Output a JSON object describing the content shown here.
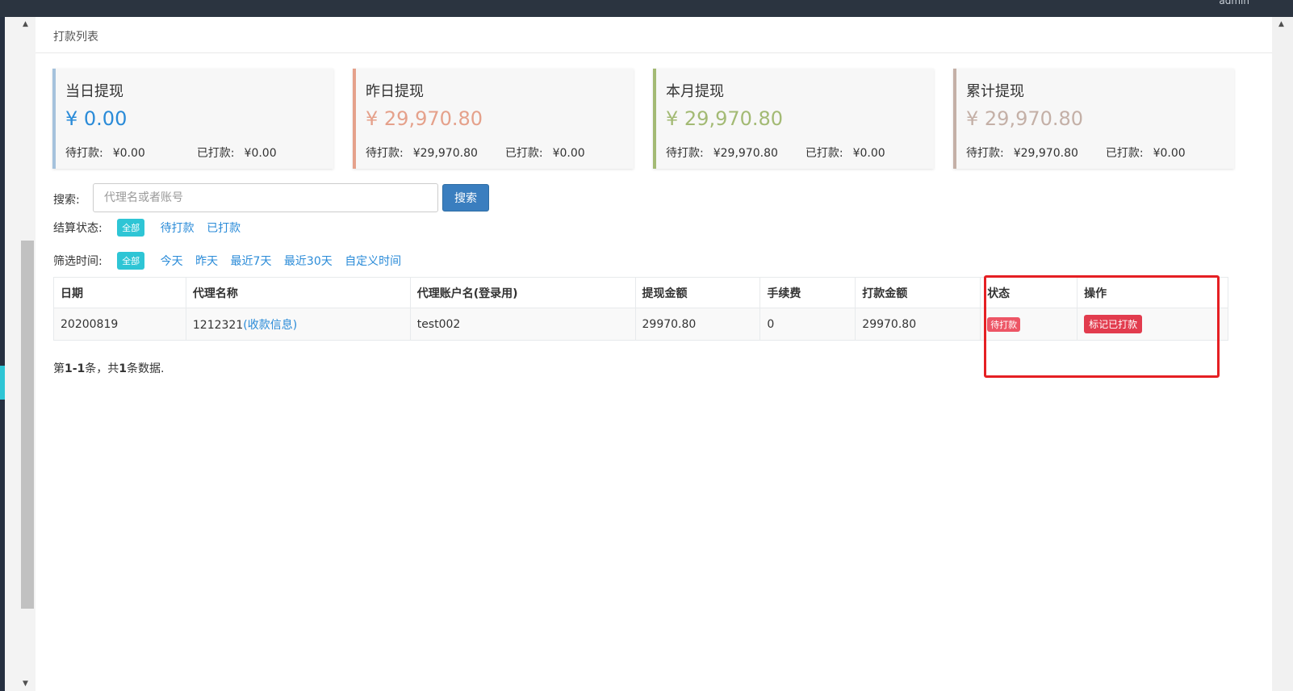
{
  "topbar": {
    "user": "admin"
  },
  "panel": {
    "title": "打款列表"
  },
  "stats": [
    {
      "title": "当日提现",
      "amount": "¥ 0.00",
      "pending_label": "待打款:",
      "pending_value": "¥0.00",
      "paid_label": "已打款:",
      "paid_value": "¥0.00",
      "accent": "#a5c2dc",
      "amount_color": "#2a8bd8"
    },
    {
      "title": "昨日提现",
      "amount": "¥ 29,970.80",
      "pending_label": "待打款:",
      "pending_value": "¥29,970.80",
      "paid_label": "已打款:",
      "paid_value": "¥0.00",
      "accent": "#e5a18b",
      "amount_color": "#e5a18b"
    },
    {
      "title": "本月提现",
      "amount": "¥ 29,970.80",
      "pending_label": "待打款:",
      "pending_value": "¥29,970.80",
      "paid_label": "已打款:",
      "paid_value": "¥0.00",
      "accent": "#a3ba74",
      "amount_color": "#a3ba74"
    },
    {
      "title": "累计提现",
      "amount": "¥ 29,970.80",
      "pending_label": "待打款:",
      "pending_value": "¥29,970.80",
      "paid_label": "已打款:",
      "paid_value": "¥0.00",
      "accent": "#c4b0a7",
      "amount_color": "#c4b0a7"
    }
  ],
  "search": {
    "label": "搜索:",
    "placeholder": "代理名或者账号",
    "button": "搜索"
  },
  "status_filter": {
    "label": "结算状态:",
    "active": "全部",
    "options": [
      "待打款",
      "已打款"
    ]
  },
  "time_filter": {
    "label": "筛选时间:",
    "active": "全部",
    "options": [
      "今天",
      "昨天",
      "最近7天",
      "最近30天",
      "自定义时间"
    ]
  },
  "table": {
    "headers": [
      "日期",
      "代理名称",
      "代理账户名(登录用)",
      "提现金额",
      "手续费",
      "打款金额",
      "状态",
      "操作"
    ],
    "rows": [
      {
        "date": "20200819",
        "agent": "1212321",
        "agent_link": "(收款信息)",
        "account": "test002",
        "withdraw": "29970.80",
        "fee": "0",
        "paid": "29970.80",
        "status": "待打款",
        "action": "标记已打款"
      }
    ]
  },
  "summary": {
    "prefix": "第",
    "range": "1-1",
    "mid": "条，共",
    "total": "1",
    "suffix": "条数据."
  },
  "colors": {
    "accent_cyan": "#2ec5d5",
    "link_blue": "#2a8bd8",
    "danger_red": "#e23c4e",
    "highlight_red": "#e51f23"
  }
}
